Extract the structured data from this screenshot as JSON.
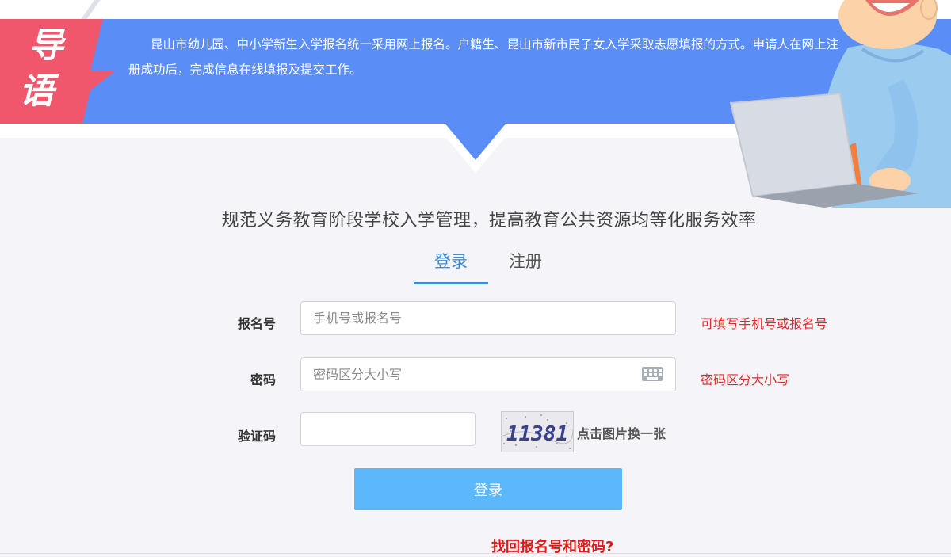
{
  "banner": {
    "tag_chars": [
      "导",
      "语"
    ],
    "intro": "昆山市幼儿园、中小学新生入学报名统一采用网上报名。户籍生、昆山市新市民子女入学采取志愿填报的方式。申请人在网上注册成功后，完成信息在线填报及提交工作。"
  },
  "headline": "规范义务教育阶段学校入学管理，提高教育公共资源均等化服务效率",
  "tabs": {
    "login": "登录",
    "register": "注册"
  },
  "form": {
    "reg_no": {
      "label": "报名号",
      "placeholder": "手机号或报名号",
      "value": "",
      "hint": "可填写手机号或报名号"
    },
    "password": {
      "label": "密码",
      "placeholder": "密码区分大小写",
      "value": "",
      "hint": "密码区分大小写",
      "icon": "keyboard-icon"
    },
    "captcha": {
      "label": "验证码",
      "value": "",
      "image_text": "11381",
      "refresh_tip": "点击图片换一张"
    },
    "submit_label": "登录",
    "forgot_link": "找回报名号和密码?"
  },
  "colors": {
    "banner_blue": "#5b8df7",
    "tag_red": "#f0566c",
    "accent_blue": "#3d8ad6",
    "button_blue": "#5cb8fb",
    "hint_red": "#e02a2a"
  }
}
